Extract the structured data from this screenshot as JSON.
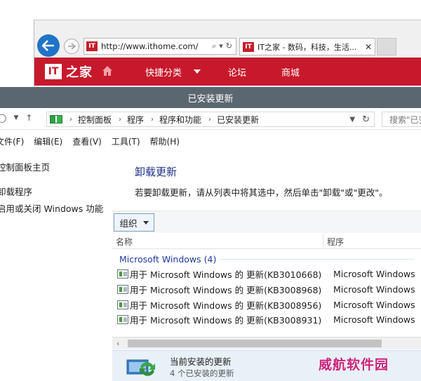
{
  "browser": {
    "url": "http://www.ithome.com/",
    "tab_title": "IT之家 - 数码，科技，生活...",
    "favicon_text": "IT",
    "site_nav": {
      "logo_text": "IT",
      "logo_script": "之家",
      "items": [
        "快捷分类",
        "论坛",
        "商城"
      ]
    },
    "brand_color": "#c7192c"
  },
  "window": {
    "title": "已安装更新"
  },
  "address": {
    "breadcrumbs": [
      "控制面板",
      "程序",
      "程序和功能",
      "已安装更新"
    ],
    "search_placeholder": "搜索\"已安装更新\""
  },
  "menu": [
    "文件(F)",
    "编辑(E)",
    "查看(V)",
    "工具(T)",
    "帮助(H)"
  ],
  "left_pane": {
    "links": [
      "控制面板主页",
      "卸载程序",
      "启用或关闭 Windows 功能"
    ]
  },
  "main": {
    "title": "卸载更新",
    "description": "若要卸载更新，请从列表中将其选中，然后单击\"卸载\"或\"更改\"。",
    "organize_label": "组织",
    "columns": {
      "name": "名称",
      "program": "程序"
    },
    "group_label": "Microsoft Windows (4)",
    "updates": [
      {
        "name": "用于 Microsoft Windows 的 更新(KB3010668)",
        "program": "Microsoft Windows"
      },
      {
        "name": "用于 Microsoft Windows 的 更新(KB3008968)",
        "program": "Microsoft Windows"
      },
      {
        "name": "用于 Microsoft Windows 的 更新(KB3008956)",
        "program": "Microsoft Windows"
      },
      {
        "name": "用于 Microsoft Windows 的 更新(KB3008931)",
        "program": "Microsoft Windows"
      }
    ]
  },
  "details": {
    "title": "当前安装的更新",
    "count": "4 个已安装的更新"
  },
  "watermark": "威航软件园"
}
